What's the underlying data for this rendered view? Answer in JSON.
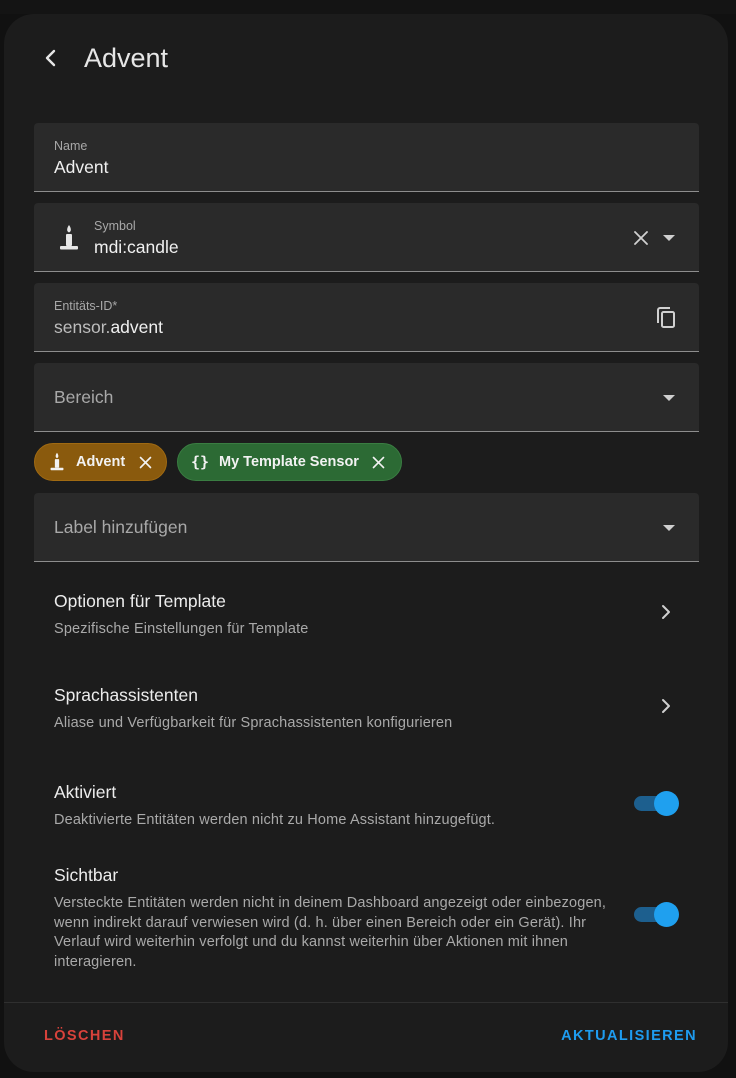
{
  "header": {
    "title": "Advent"
  },
  "fields": {
    "name": {
      "label": "Name",
      "value": "Advent"
    },
    "symbol": {
      "label": "Symbol",
      "value": "mdi:candle",
      "icon": "candle-icon"
    },
    "entity_id": {
      "label": "Entitäts-ID*",
      "prefix": "sensor.",
      "value": "advent"
    },
    "area": {
      "placeholder": "Bereich"
    },
    "labels": {
      "placeholder": "Label hinzufügen"
    }
  },
  "chips": [
    {
      "label": "Advent",
      "icon": "candle-icon",
      "color": "#8a5a0d"
    },
    {
      "label": "My Template Sensor",
      "icon": "code-braces-icon",
      "glyph": "{}",
      "color": "#2c6a34"
    }
  ],
  "options": [
    {
      "title": "Optionen für Template",
      "subtitle": "Spezifische Einstellungen für Template"
    },
    {
      "title": "Sprachassistenten",
      "subtitle": "Aliase und Verfügbarkeit für Sprachassistenten konfigurieren"
    }
  ],
  "toggles": [
    {
      "title": "Aktiviert",
      "subtitle": "Deaktivierte Entitäten werden nicht zu Home Assistant hinzugefügt.",
      "on": true
    },
    {
      "title": "Sichtbar",
      "subtitle": "Versteckte Entitäten werden nicht in deinem Dashboard angezeigt oder einbezogen, wenn indirekt darauf verwiesen wird (d. h. über einen Bereich oder ein Gerät). Ihr Verlauf wird weiterhin verfolgt und du kannst weiterhin über Aktionen mit ihnen interagieren.",
      "on": true
    }
  ],
  "footer": {
    "delete_label": "LÖSCHEN",
    "update_label": "AKTUALISIEREN"
  },
  "colors": {
    "accent": "#1e9cf0",
    "danger": "#d8423b",
    "surface": "#1c1c1c",
    "field": "#2a2a2a"
  }
}
